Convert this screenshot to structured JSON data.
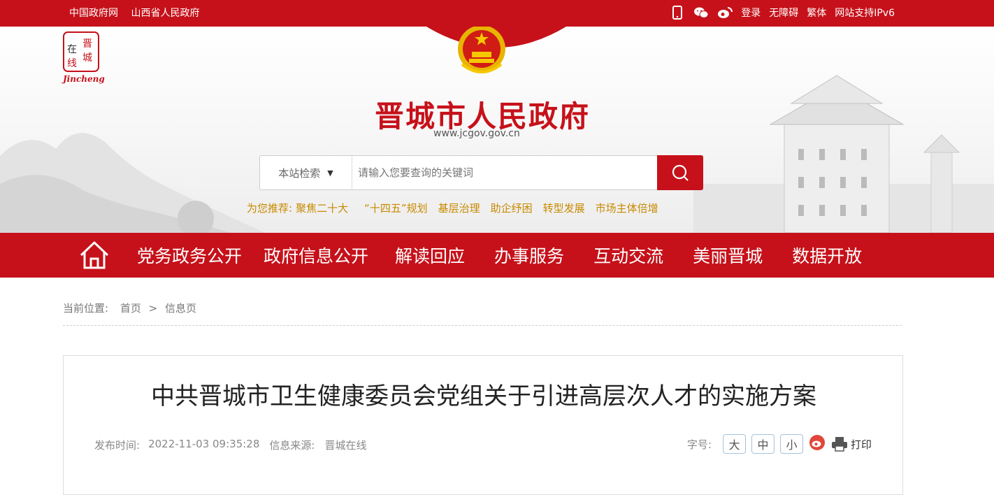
{
  "topbar": {
    "links": [
      "中国政府网",
      "山西省人民政府"
    ],
    "login": "登录",
    "accessible": "无障碍",
    "traditional": "繁体",
    "ipv6": "网站支持IPv6"
  },
  "header": {
    "logo_chars": [
      "晋",
      "城",
      "在",
      "线"
    ],
    "logo_caption": "Jincheng",
    "title": "晋城市人民政府",
    "url": "www.jcgov.gov.cn"
  },
  "search": {
    "scope": "本站检索",
    "placeholder": "请输入您要查询的关键词"
  },
  "recommend": {
    "label": "为您推荐:",
    "items": [
      "聚焦二十大",
      "“十四五”规划",
      "基层治理",
      "助企纾困",
      "转型发展",
      "市场主体倍增"
    ]
  },
  "nav": {
    "items": [
      "党务政务公开",
      "政府信息公开",
      "解读回应",
      "办事服务",
      "互动交流",
      "美丽晋城",
      "数据开放"
    ]
  },
  "breadcrumb": {
    "label": "当前位置:",
    "home": "首页",
    "sep": ">",
    "current": "信息页"
  },
  "article": {
    "title": "中共晋城市卫生健康委员会党组关于引进高层次人才的实施方案",
    "time_label": "发布时间:",
    "time": "2022-11-03 09:35:28",
    "source_label": "信息来源:",
    "source": "晋城在线",
    "font_label": "字号:",
    "font_large": "大",
    "font_medium": "中",
    "font_small": "小",
    "print": "打印"
  },
  "colors": {
    "brand_red": "#c6111a",
    "recommend": "#c68a00"
  }
}
